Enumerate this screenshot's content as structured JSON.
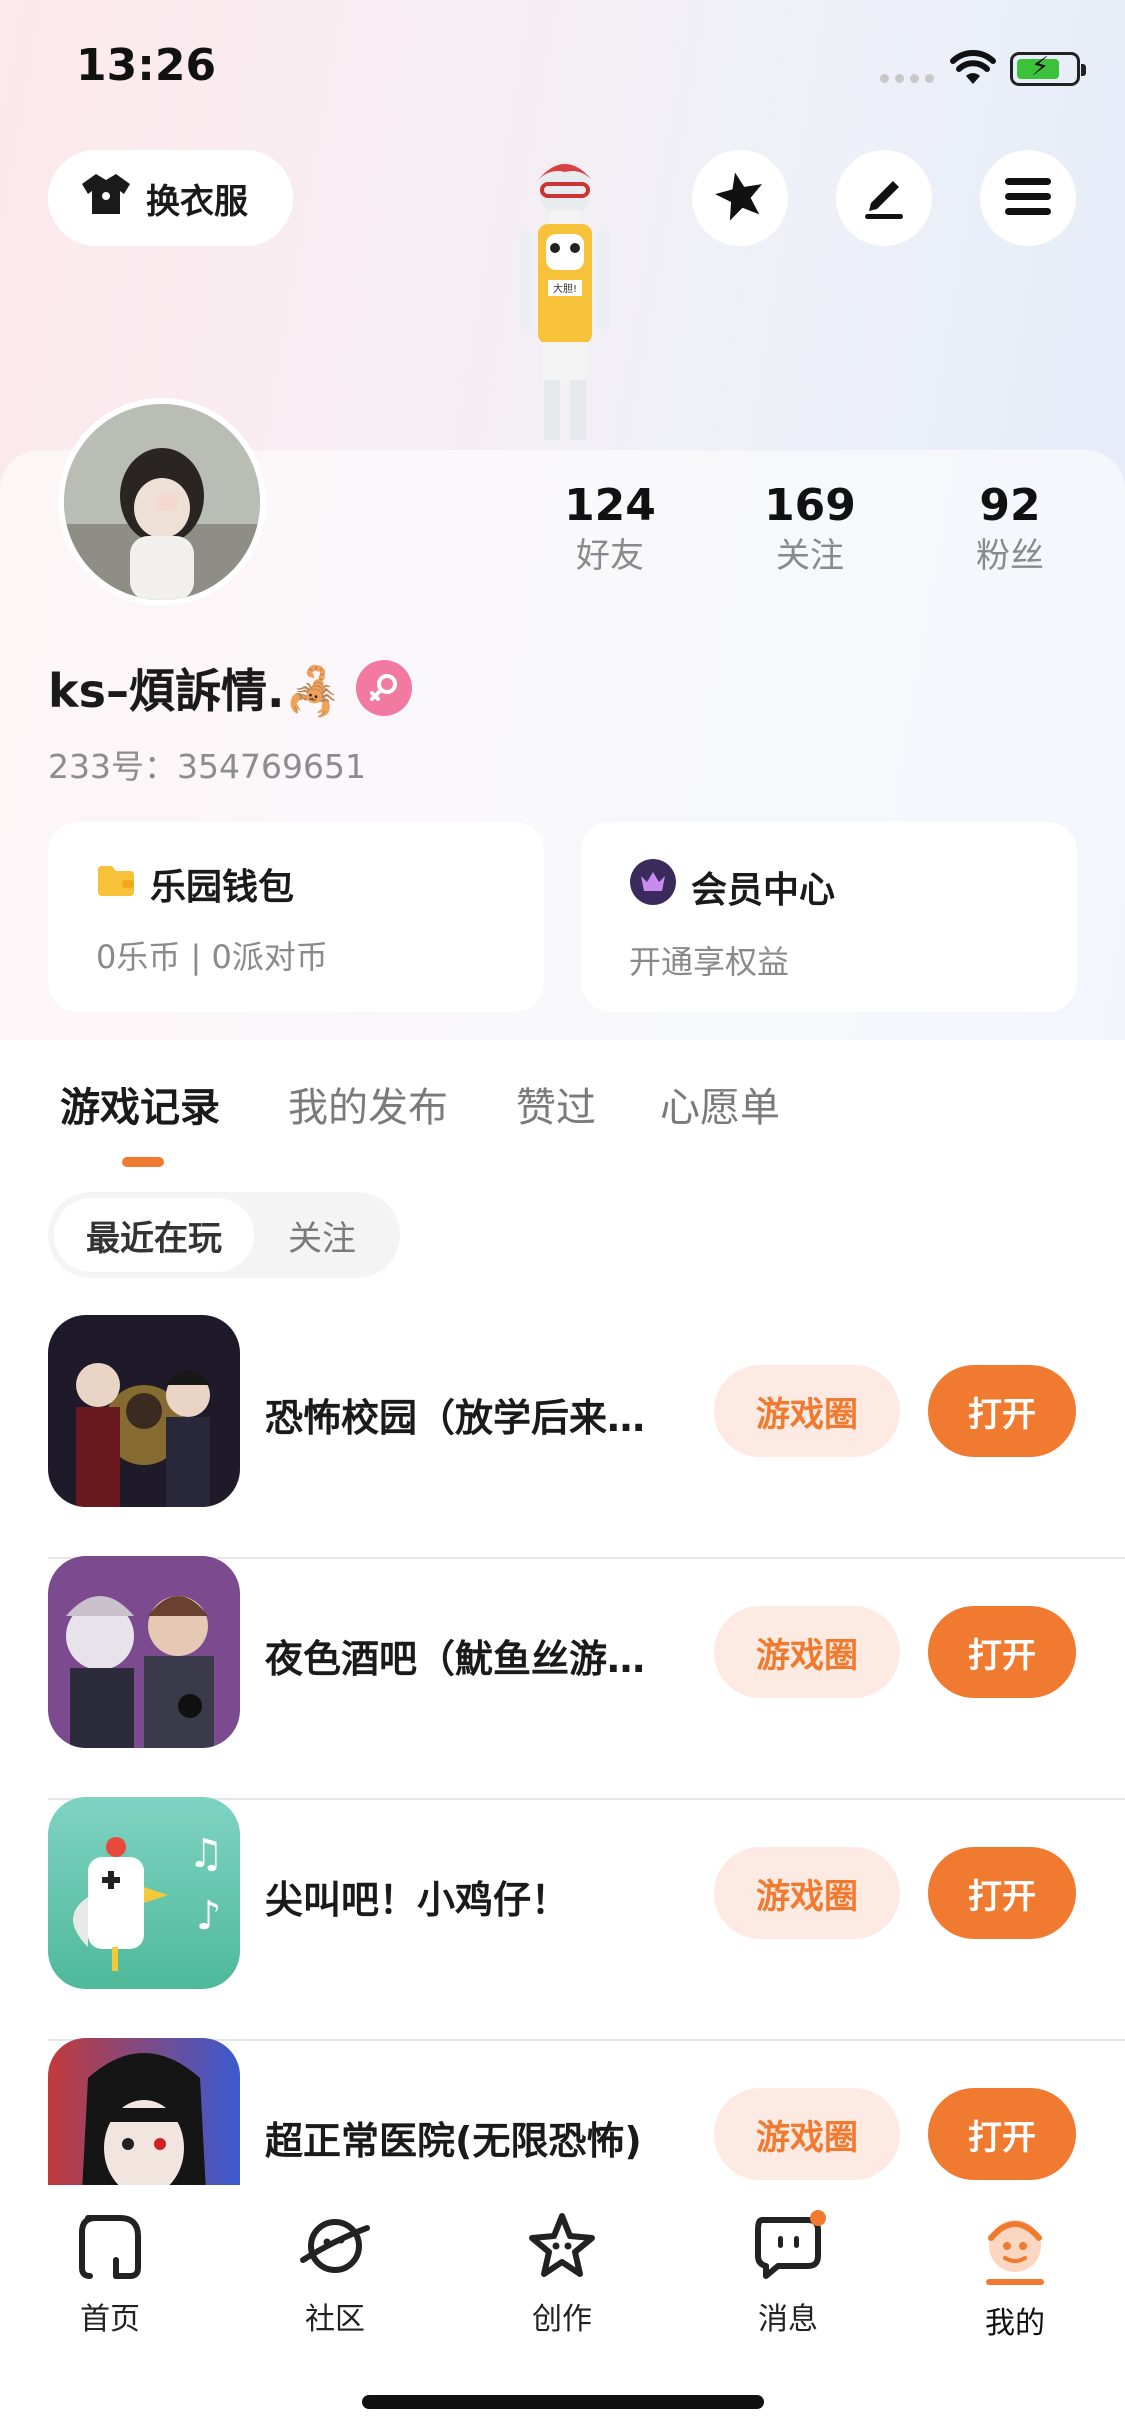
{
  "status_bar": {
    "time": "13:26"
  },
  "header": {
    "outfit_label": "换衣服",
    "avatar_sign": "大胆!"
  },
  "profile": {
    "username": "ks–煩訴情.🦂",
    "uid_text": "233号：354769651",
    "stats": [
      {
        "value": "124",
        "label": "好友"
      },
      {
        "value": "169",
        "label": "关注"
      },
      {
        "value": "92",
        "label": "粉丝"
      }
    ]
  },
  "cards": {
    "wallet": {
      "title": "乐园钱包",
      "sub": "0乐币 | 0派对币"
    },
    "vip": {
      "title": "会员中心",
      "sub": "开通享权益"
    }
  },
  "tabs": [
    "游戏记录",
    "我的发布",
    "赞过",
    "心愿单"
  ],
  "filter": {
    "active": "最近在玩",
    "other": "关注"
  },
  "games": [
    {
      "title": "恐怖校园（放学后来…",
      "circle": "游戏圈",
      "open": "打开"
    },
    {
      "title": "夜色酒吧（魷鱼丝游…",
      "circle": "游戏圈",
      "open": "打开"
    },
    {
      "title": "尖叫吧！小鸡仔！",
      "circle": "游戏圈",
      "open": "打开"
    },
    {
      "title": "超正常医院(无限恐怖)",
      "circle": "游戏圈",
      "open": "打开"
    }
  ],
  "tabbar": [
    {
      "label": "首页",
      "icon": "home-icon"
    },
    {
      "label": "社区",
      "icon": "planet-icon"
    },
    {
      "label": "创作",
      "icon": "star-icon"
    },
    {
      "label": "消息",
      "icon": "chat-icon"
    },
    {
      "label": "我的",
      "icon": "profile-face-icon"
    }
  ],
  "colors": {
    "accent": "#f07a2f",
    "accent_soft": "#fdeae3",
    "female": "#f27aa0"
  }
}
